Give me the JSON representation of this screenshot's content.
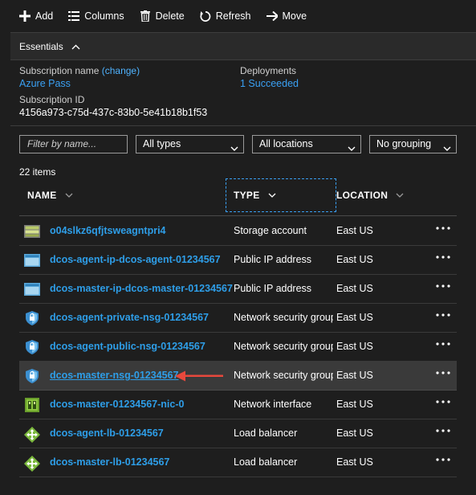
{
  "toolbar": {
    "add": "Add",
    "columns": "Columns",
    "delete": "Delete",
    "refresh": "Refresh",
    "move": "Move"
  },
  "essentials": {
    "title": "Essentials",
    "subscription_name_label": "Subscription name",
    "change_link": "(change)",
    "subscription_name": "Azure Pass",
    "subscription_id_label": "Subscription ID",
    "subscription_id": "4156a973-c75d-437c-83b0-5e41b18b1f53",
    "deployments_label": "Deployments",
    "deployments_value": "1 Succeeded"
  },
  "filters": {
    "name_placeholder": "Filter by name...",
    "type": "All types",
    "location": "All locations",
    "grouping": "No grouping"
  },
  "items_count": "22 items",
  "columns": {
    "name": "NAME",
    "type": "TYPE",
    "location": "LOCATION"
  },
  "rows": [
    {
      "name": "o04slkz6qfjtsweagntpri4",
      "type": "Storage account",
      "location": "East US",
      "icon": "storage-account-icon"
    },
    {
      "name": "dcos-agent-ip-dcos-agent-01234567",
      "type": "Public IP address",
      "location": "East US",
      "icon": "public-ip-icon"
    },
    {
      "name": "dcos-master-ip-dcos-master-01234567",
      "type": "Public IP address",
      "location": "East US",
      "icon": "public-ip-icon"
    },
    {
      "name": "dcos-agent-private-nsg-01234567",
      "type": "Network security group",
      "location": "East US",
      "icon": "network-security-group-icon"
    },
    {
      "name": "dcos-agent-public-nsg-01234567",
      "type": "Network security group",
      "location": "East US",
      "icon": "network-security-group-icon"
    },
    {
      "name": "dcos-master-nsg-01234567",
      "type": "Network security group",
      "location": "East US",
      "icon": "network-security-group-icon"
    },
    {
      "name": "dcos-master-01234567-nic-0",
      "type": "Network interface",
      "location": "East US",
      "icon": "network-interface-icon"
    },
    {
      "name": "dcos-agent-lb-01234567",
      "type": "Load balancer",
      "location": "East US",
      "icon": "load-balancer-icon"
    },
    {
      "name": "dcos-master-lb-01234567",
      "type": "Load balancer",
      "location": "East US",
      "icon": "load-balancer-icon"
    }
  ],
  "colors": {
    "link": "#2e9ee8",
    "arrow": "#e8483c",
    "background": "#1e1e1e"
  }
}
